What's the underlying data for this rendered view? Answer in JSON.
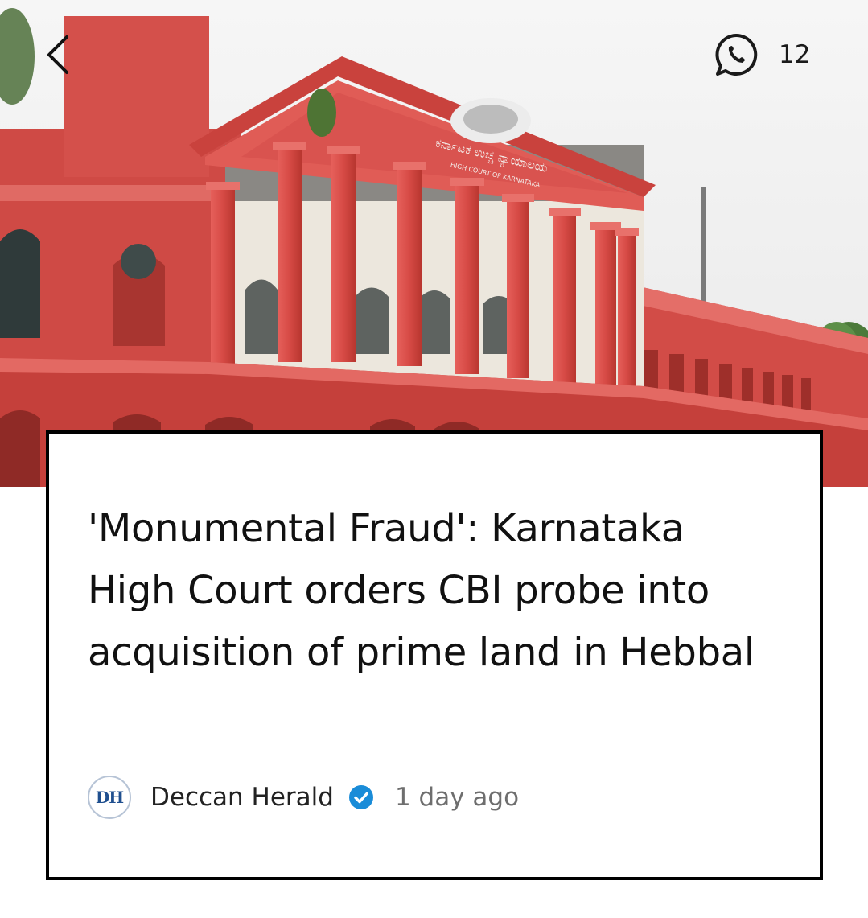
{
  "header": {
    "back_icon": "chevron-left-icon",
    "share_icon": "whatsapp-icon",
    "share_count": "12"
  },
  "hero": {
    "image_subject": "courthouse-photo",
    "inscription_line1": "ಕರ್ನಾಟಕ ಉಚ್ಚ ನ್ಯಾಯಾಲಯ",
    "inscription_line2": "HIGH COURT OF KARNATAKA"
  },
  "article": {
    "headline": "'Monumental Fraud': Karnataka High Court orders CBI probe into acquisition of prime land in Hebbal",
    "source_logo_text": "DH",
    "source_name": "Deccan Herald",
    "verified_icon": "verified-badge-icon",
    "time_ago": "1 day ago"
  },
  "colors": {
    "building_red": "#d9534f",
    "building_dark": "#b83a36",
    "sky": "#f1f1f1",
    "verified_blue": "#1a8cd8",
    "card_border": "#000000"
  }
}
